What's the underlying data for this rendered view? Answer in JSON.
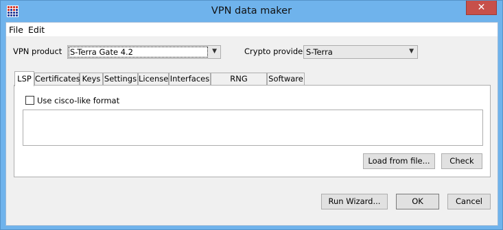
{
  "window": {
    "title": "VPN data maker",
    "close_glyph": "✕"
  },
  "menu": {
    "items": [
      "File",
      "Edit"
    ]
  },
  "form": {
    "vpn_product_label": "VPN product",
    "vpn_product_value": "S-Terra Gate 4.2",
    "crypto_provider_label": "Crypto provider",
    "crypto_provider_value": "S-Terra"
  },
  "tabs": [
    "LSP",
    "Certificates",
    "Keys",
    "Settings",
    "License",
    "Interfaces",
    "RNG Container",
    "Software"
  ],
  "active_tab": "LSP",
  "lsp": {
    "cisco_format_label": "Use cisco-like format",
    "cisco_format_checked": false,
    "load_button": "Load from file...",
    "check_button": "Check"
  },
  "footer": {
    "wizard_button": "Run Wizard...",
    "ok_button": "OK",
    "cancel_button": "Cancel"
  },
  "icons": {
    "app": "app-grid-icon",
    "close": "close-icon",
    "dropdown": "chevron-down-icon"
  },
  "colors": {
    "titlebar": "#6fb3ec",
    "close": "#c7504a"
  }
}
